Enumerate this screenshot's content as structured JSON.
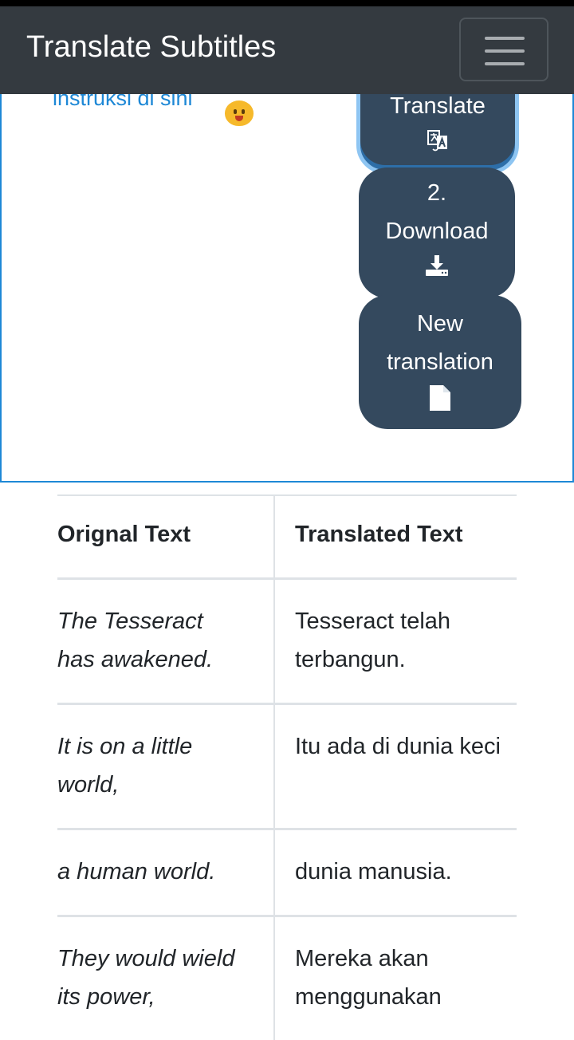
{
  "navbar": {
    "brand": "Translate Subtitles",
    "toggler_icon": "hamburger-menu-icon"
  },
  "panel": {
    "instruction_link": "instruksi di sini",
    "emoji_icon": "smiley-emoji-icon",
    "buttons": {
      "translate": {
        "label": "Translate",
        "icon": "translate-icon"
      },
      "download": {
        "step": "2.",
        "label": "Download",
        "icon": "download-icon"
      },
      "new_translation": {
        "line1": "New",
        "line2": "translation",
        "icon": "file-icon"
      }
    }
  },
  "table": {
    "headers": {
      "original": "Orignal Text",
      "translated": "Translated Text"
    },
    "rows": [
      {
        "original_1": "The Tesseract",
        "original_2": "has awakened.",
        "translated_1": "Tesseract telah",
        "translated_2": "terbangun."
      },
      {
        "original_1": "It is on a little",
        "original_2": "world,",
        "translated_1": "Itu ada di dunia keci",
        "translated_2": ""
      },
      {
        "original_1": "a human world.",
        "original_2": "",
        "translated_1": "dunia manusia.",
        "translated_2": ""
      },
      {
        "original_1": "They would wield",
        "original_2": "its power,",
        "translated_1": "Mereka akan",
        "translated_2": "menggunakan"
      }
    ]
  },
  "colors": {
    "navbar_bg": "#343a40",
    "button_bg": "#34495e",
    "link": "#1e88d6",
    "focus_ring": "#8ec5f2"
  }
}
